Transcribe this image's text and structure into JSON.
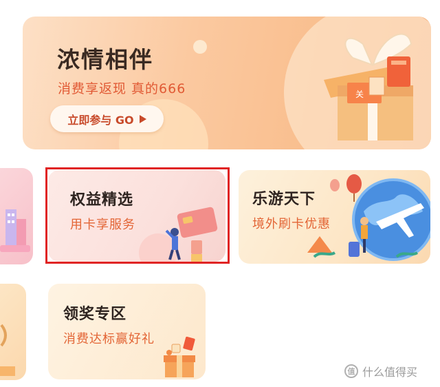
{
  "hero": {
    "title": "浓情相伴",
    "subtitle": "消费享返现 真的666",
    "button_label": "立即参与 GO",
    "gift_tag": "关"
  },
  "tiles": [
    {
      "title": "权益精选",
      "subtitle": "用卡享服务"
    },
    {
      "title": "乐游天下",
      "subtitle": "境外刷卡优惠"
    },
    {
      "title": "领奖专区",
      "subtitle": "消费达标赢好礼"
    }
  ],
  "watermark": {
    "text": "什么值得买",
    "icon": "值"
  },
  "colors": {
    "accent_orange": "#e36536",
    "highlight_border": "#e02424",
    "title_dark": "#2e2420"
  }
}
